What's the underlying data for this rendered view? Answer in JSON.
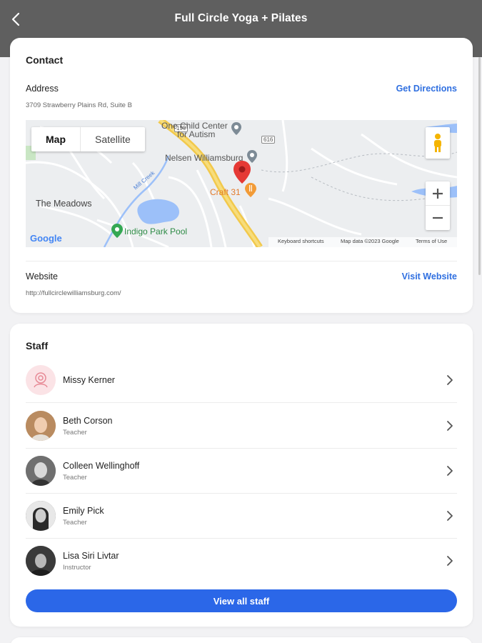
{
  "header": {
    "title": "Full Circle Yoga + Pilates"
  },
  "contact": {
    "title": "Contact",
    "address_label": "Address",
    "address_value": "3709 Strawberry Plains Rd, Suite B",
    "directions_link": "Get Directions",
    "website_label": "Website",
    "website_value": "http://fullcirclewilliamsburg.com/",
    "website_link": "Visit Website"
  },
  "map": {
    "type_map": "Map",
    "type_satellite": "Satellite",
    "labels": {
      "center": "One Child Center\nfor Autism",
      "center_line1": "One Child Center",
      "center_line2": "for Autism",
      "nelsen": "Nelsen Williamsburg",
      "craft": "Craft 31",
      "meadows": "The Meadows",
      "indigo": "Indigo Park Pool",
      "mill_creek": "Mill Creek",
      "road_199": "199",
      "road_616": "616"
    },
    "footer": {
      "shortcuts": "Keyboard shortcuts",
      "mapdata": "Map data ©2023 Google",
      "terms": "Terms of Use"
    },
    "logo": "Google"
  },
  "staff": {
    "title": "Staff",
    "members": [
      {
        "name": "Missy Kerner",
        "role": ""
      },
      {
        "name": "Beth Corson",
        "role": "Teacher"
      },
      {
        "name": "Colleen Wellinghoff",
        "role": "Teacher"
      },
      {
        "name": "Emily Pick",
        "role": "Teacher"
      },
      {
        "name": "Lisa Siri Livtar",
        "role": "Instructor"
      }
    ],
    "view_all": "View all staff"
  },
  "colors": {
    "accent": "#2b67e8",
    "link": "#2f6fe0",
    "header": "#5f5f5f",
    "pin": "#e53935"
  }
}
